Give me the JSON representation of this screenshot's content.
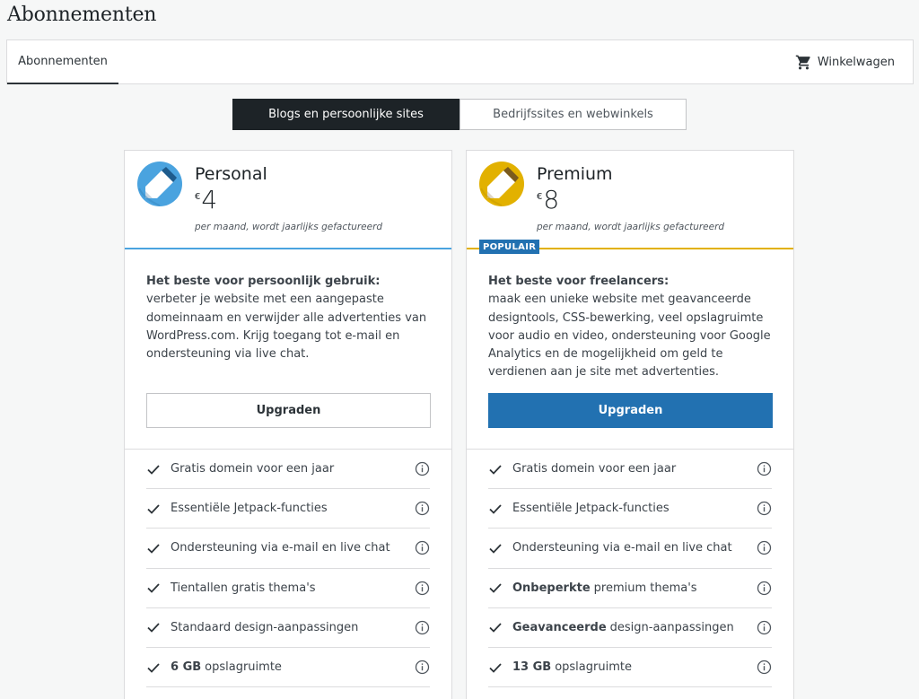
{
  "page_title": "Abonnementen",
  "nav": {
    "tab_label": "Abonnementen",
    "cart_label": "Winkelwagen"
  },
  "toggle": {
    "option_1": "Blogs en persoonlijke sites",
    "option_2": "Bedrijfssites en webwinkels"
  },
  "plans": [
    {
      "name": "Personal",
      "currency": "€",
      "price": "4",
      "billing": "per maand, wordt jaarlijks gefactureerd",
      "desc_title": "Het beste voor persoonlijk gebruik:",
      "desc_body": "verbeter je website met een aangepaste domeinnaam en verwijder alle advertenties van WordPress.com. Krijg toegang tot e-mail en ondersteuning via live chat.",
      "button": "Upgraden",
      "features": [
        {
          "bold": "",
          "text": "Gratis domein voor een jaar"
        },
        {
          "bold": "",
          "text": "Essentiële Jetpack-functies"
        },
        {
          "bold": "",
          "text": "Ondersteuning via e-mail en live chat"
        },
        {
          "bold": "",
          "text": "Tientallen gratis thema's"
        },
        {
          "bold": "",
          "text": "Standaard design-aanpassingen"
        },
        {
          "bold": "6 GB",
          "text": "opslagruimte"
        }
      ]
    },
    {
      "name": "Premium",
      "currency": "€",
      "price": "8",
      "billing": "per maand, wordt jaarlijks gefactureerd",
      "badge": "POPULAIR",
      "desc_title": "Het beste voor freelancers:",
      "desc_body": "maak een unieke website met geavanceerde designtools, CSS-bewerking, veel opslagruimte voor audio en video, ondersteuning voor Google Analytics en de mogelijkheid om geld te verdienen aan je site met advertenties.",
      "button": "Upgraden",
      "features": [
        {
          "bold": "",
          "text": "Gratis domein voor een jaar"
        },
        {
          "bold": "",
          "text": "Essentiële Jetpack-functies"
        },
        {
          "bold": "",
          "text": "Ondersteuning via e-mail en live chat"
        },
        {
          "bold": "Onbeperkte",
          "text": "premium thema's"
        },
        {
          "bold": "Geavanceerde",
          "text": "design-aanpassingen"
        },
        {
          "bold": "13 GB",
          "text": "opslagruimte"
        }
      ]
    }
  ],
  "colors": {
    "personal_accent": "#4aa3df",
    "premium_accent": "#e2b100",
    "primary_button": "#2271b1",
    "toggle_active": "#1d2327"
  }
}
